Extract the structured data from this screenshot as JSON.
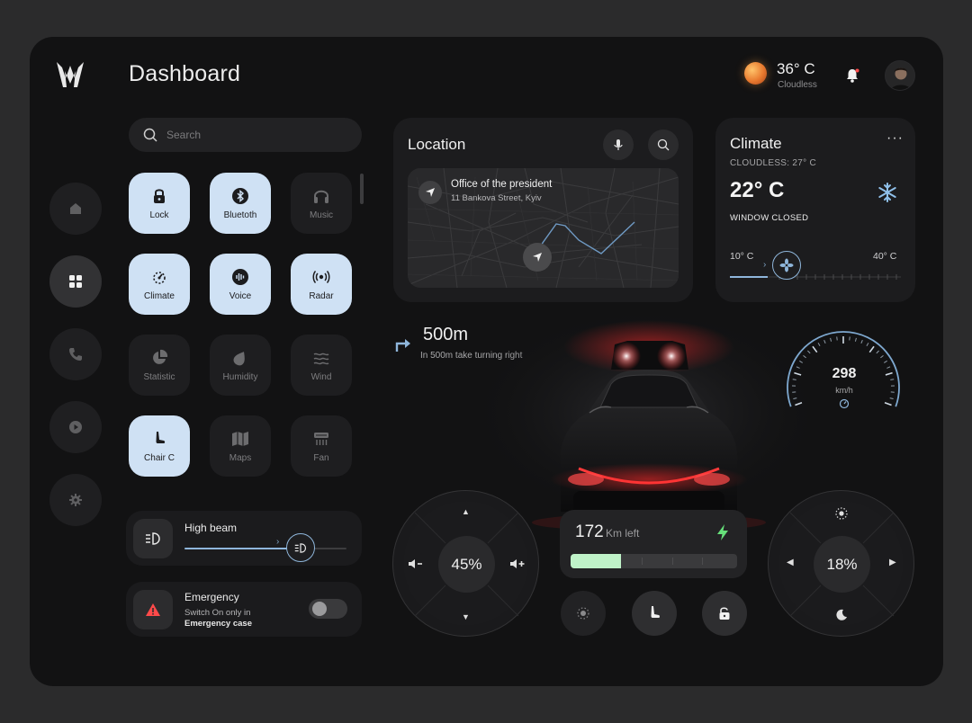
{
  "header": {
    "title": "Dashboard"
  },
  "weather": {
    "temperature": "36° C",
    "condition": "Cloudless"
  },
  "search": {
    "placeholder": "Search"
  },
  "sidebar": {
    "items": [
      {
        "name": "home",
        "icon": "home-icon"
      },
      {
        "name": "apps",
        "icon": "grid-icon",
        "active": true
      },
      {
        "name": "phone",
        "icon": "phone-icon"
      },
      {
        "name": "media",
        "icon": "play-icon"
      },
      {
        "name": "settings",
        "icon": "gear-icon"
      }
    ]
  },
  "controls": [
    {
      "label": "Lock",
      "icon": "lock-icon",
      "on": true
    },
    {
      "label": "Bluetoth",
      "icon": "bluetooth-icon",
      "on": true
    },
    {
      "label": "Music",
      "icon": "headphones-icon",
      "on": false
    },
    {
      "label": "Climate",
      "icon": "gauge-icon",
      "on": true
    },
    {
      "label": "Voice",
      "icon": "voice-icon",
      "on": true
    },
    {
      "label": "Radar",
      "icon": "radar-icon",
      "on": true
    },
    {
      "label": "Statistic",
      "icon": "pie-icon",
      "on": false
    },
    {
      "label": "Humidity",
      "icon": "drop-icon",
      "on": false
    },
    {
      "label": "Wind",
      "icon": "wind-icon",
      "on": false
    },
    {
      "label": "Chair C",
      "icon": "seat-icon",
      "on": true
    },
    {
      "label": "Maps",
      "icon": "map-icon",
      "on": false
    },
    {
      "label": "Fan",
      "icon": "fan-icon",
      "on": false
    }
  ],
  "high_beam": {
    "label": "High beam",
    "level": 0.72
  },
  "emergency": {
    "title": "Emergency",
    "line1": "Switch On only in",
    "line2": "Emergency case",
    "enabled": false
  },
  "location": {
    "title": "Location",
    "destination": "Office of the president",
    "address": "11 Bankova Street, Kyiv"
  },
  "climate": {
    "title": "Climate",
    "subtitle": "CLOUDLESS: 27° C",
    "temperature": "22° C",
    "window_status": "WINDOW CLOSED",
    "min_label": "10° C",
    "max_label": "40° C",
    "level": 0.22
  },
  "navigation": {
    "distance": "500m",
    "instruction": "In 500m take turning right"
  },
  "speed": {
    "value": "298",
    "unit": "km/h"
  },
  "volume_dial": {
    "value": "45%"
  },
  "range": {
    "value": "172",
    "unit": "Km left",
    "charge": 0.3
  },
  "fan_dial": {
    "value": "18%"
  },
  "colors": {
    "accent": "#cfe1f4",
    "charge": "#bff2c8",
    "brake": "#ff3b3b",
    "bolt": "#66e07a",
    "alert": "#ff4a4a"
  }
}
